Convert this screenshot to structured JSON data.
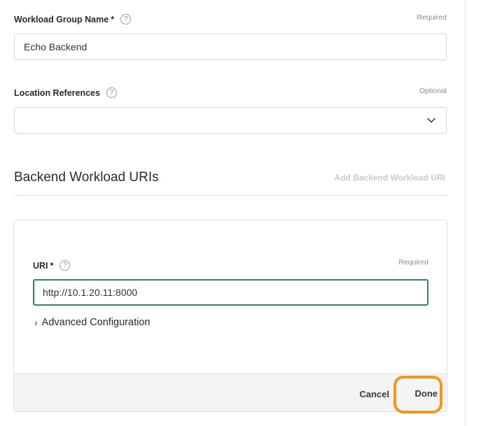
{
  "workload_group": {
    "label": "Workload Group Name",
    "required_mark": "*",
    "help": "?",
    "hint": "Required",
    "value": "Echo Backend"
  },
  "location_refs": {
    "label": "Location References",
    "help": "?",
    "hint": "Optional",
    "value": ""
  },
  "backend_section": {
    "title": "Backend Workload URIs",
    "add_link": "Add Backend Workload URI"
  },
  "uri_card": {
    "label": "URI",
    "required_mark": "*",
    "help": "?",
    "hint": "Required",
    "value": "http://10.1.20.11:8000",
    "advanced_caret": "›",
    "advanced_label": "Advanced Configuration",
    "cancel_label": "Cancel",
    "done_label": "Done"
  },
  "colors": {
    "input_focus_border": "#2e8b57",
    "highlight_ring": "#f7941d",
    "disabled_link": "#c9c9c9"
  }
}
